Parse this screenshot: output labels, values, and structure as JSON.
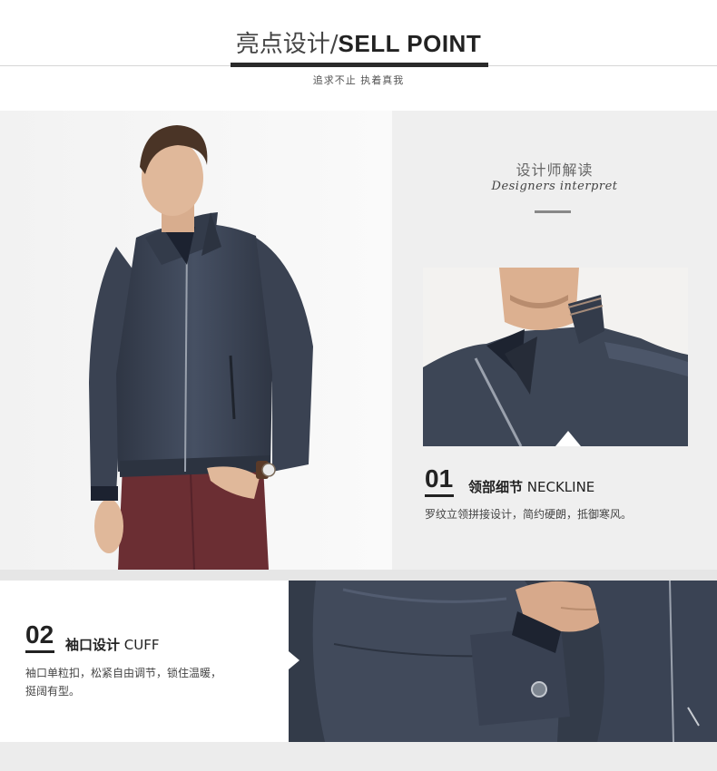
{
  "header": {
    "title_cn": "亮点设计/",
    "title_en": "SELL POINT",
    "subtitle": "追求不止 执着真我"
  },
  "interpret": {
    "title_cn": "设计师解读",
    "title_en": "Designers interpret"
  },
  "features": [
    {
      "number": "01",
      "title_cn": "领部细节",
      "title_en": "NECKLINE",
      "description": "罗纹立领拼接设计，简约硬朗，抵御寒风。"
    },
    {
      "number": "02",
      "title_cn": "袖口设计",
      "title_en": "CUFF",
      "description_line1": "袖口单粒扣，松紧自由调节，锁住温暖，",
      "description_line2": "挺阔有型。"
    }
  ],
  "colors": {
    "jacket": "#3f4858",
    "jacket_dark": "#2c3340",
    "pants": "#6b2e33",
    "skin": "#e0b89a",
    "hair": "#4a3426",
    "panel_bg": "#efefef"
  }
}
